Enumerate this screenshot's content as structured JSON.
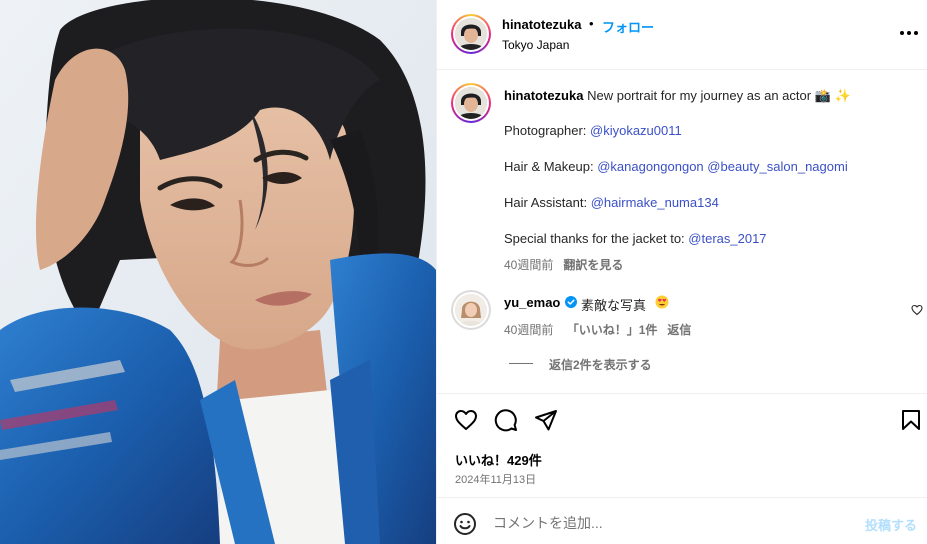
{
  "post": {
    "photo_alt": "portrait-photo",
    "author": {
      "username": "hinatotezuka",
      "separator": "•",
      "follow_label": "フォロー",
      "location": "Tokyo Japan"
    },
    "more_icon": "more-horizontal-icon"
  },
  "caption": {
    "username": "hinatotezuka",
    "text": "New portrait for my journey as an actor 📸 ✨",
    "lines": [
      {
        "label": "Photographer: ",
        "mentions": [
          "@kiyokazu0011"
        ]
      },
      {
        "label": "Hair & Makeup: ",
        "mentions": [
          "@kanagongongon",
          "@beauty_salon_nagomi"
        ]
      },
      {
        "label": "Hair Assistant: ",
        "mentions": [
          "@hairmake_numa134"
        ]
      },
      {
        "label": "Special thanks for the jacket to: ",
        "mentions": [
          "@teras_2017"
        ]
      }
    ],
    "time": "40週間前",
    "translate_label": "翻訳を見る"
  },
  "comment": {
    "username": "yu_emao",
    "verified": true,
    "text": "素敵な写真",
    "emoji": "smiling-face-with-heart-eyes",
    "time": "40週間前",
    "likes": "「いいね！」1件",
    "reply_label": "返信",
    "view_replies": "返信2件を表示する"
  },
  "actions": {
    "icons": [
      "heart-icon",
      "comment-icon",
      "share-icon",
      "bookmark-icon"
    ],
    "likes": "いいね！429件",
    "date": "2024年11月13日"
  },
  "composer": {
    "placeholder": "コメントを追加...",
    "post_label": "投稿する"
  },
  "colors": {
    "link": "#3b50c7",
    "follow": "#0095f6",
    "muted": "#737373",
    "post_disabled": "#b2dffc",
    "verified": "#0095f6"
  }
}
